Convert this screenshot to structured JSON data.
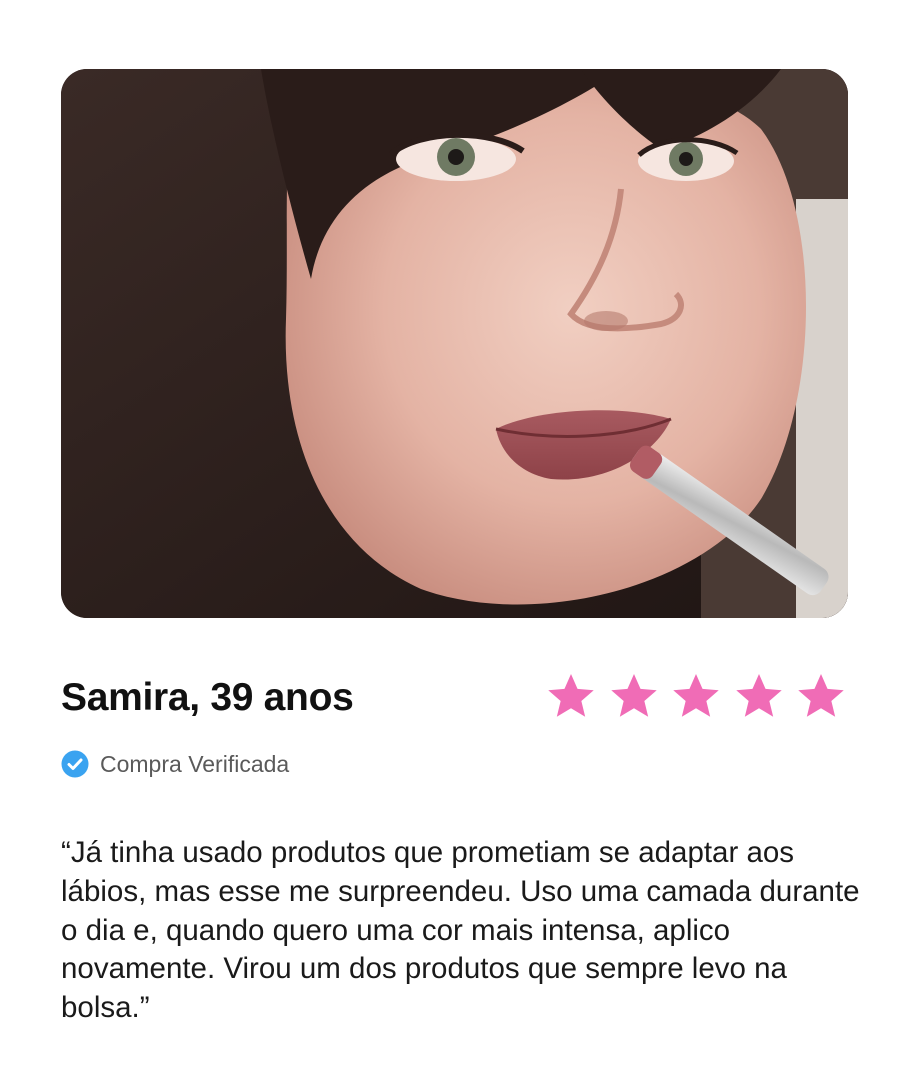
{
  "review": {
    "reviewer": "Samira, 39 anos",
    "rating": 5,
    "max_rating": 5,
    "verified_label": "Compra Verificada",
    "text": "“Já tinha usado produtos que prometiam se adaptar aos lábios, mas esse me surpreendeu. Uso uma camada durante o dia e, quando quero uma cor mais intensa, aplico novamente. Virou um dos produtos que sempre levo na bolsa.”"
  },
  "colors": {
    "star": "#f06cb6",
    "verified_badge": "#3aa3f0",
    "text": "#111111",
    "muted": "#5a5a5a"
  },
  "icons": {
    "rating": "star-icon",
    "verified": "check-badge-icon"
  }
}
